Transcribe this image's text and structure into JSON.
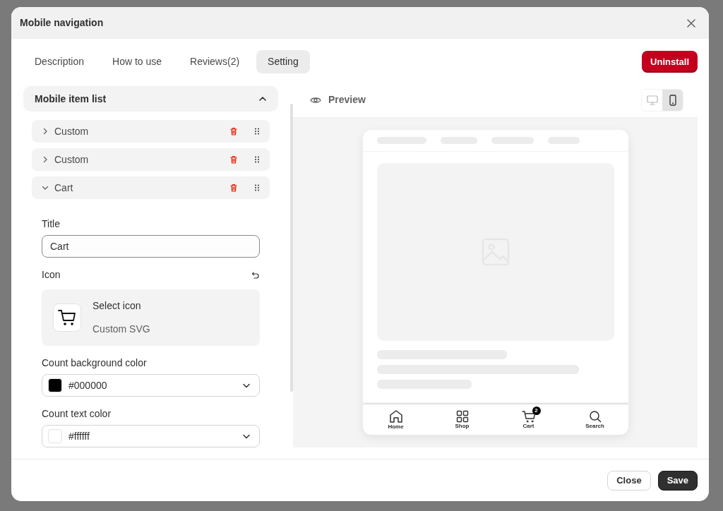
{
  "modal": {
    "title": "Mobile navigation"
  },
  "tabs": [
    {
      "label": "Description",
      "selected": false
    },
    {
      "label": "How to use",
      "selected": false
    },
    {
      "label": "Reviews(2)",
      "selected": false
    },
    {
      "label": "Setting",
      "selected": true
    }
  ],
  "uninstall_button": "Uninstall",
  "item_list": {
    "title": "Mobile item list",
    "expanded": true,
    "items": [
      {
        "label": "Custom",
        "expanded": false
      },
      {
        "label": "Custom",
        "expanded": false
      },
      {
        "label": "Cart",
        "expanded": true
      }
    ]
  },
  "item_settings": {
    "title_label": "Title",
    "title_value": "Cart",
    "icon_label": "Icon",
    "icon_select": "Select icon",
    "icon_subtitle": "Custom SVG",
    "colors": [
      {
        "label": "Count background color",
        "value": "#000000"
      },
      {
        "label": "Count text color",
        "value": "#ffffff"
      }
    ]
  },
  "preview": {
    "title": "Preview",
    "devices": [
      {
        "kind": "desktop",
        "selected": false
      },
      {
        "kind": "mobile",
        "selected": true
      }
    ],
    "nav": [
      {
        "kind": "home",
        "label": "Home"
      },
      {
        "kind": "shop",
        "label": "Shop"
      },
      {
        "kind": "cart",
        "label": "Cart",
        "badge": "2"
      },
      {
        "kind": "search",
        "label": "Search"
      }
    ]
  },
  "footer_buttons": [
    {
      "kind": "secondary",
      "label": "Close"
    },
    {
      "kind": "primary",
      "label": "Save"
    }
  ]
}
